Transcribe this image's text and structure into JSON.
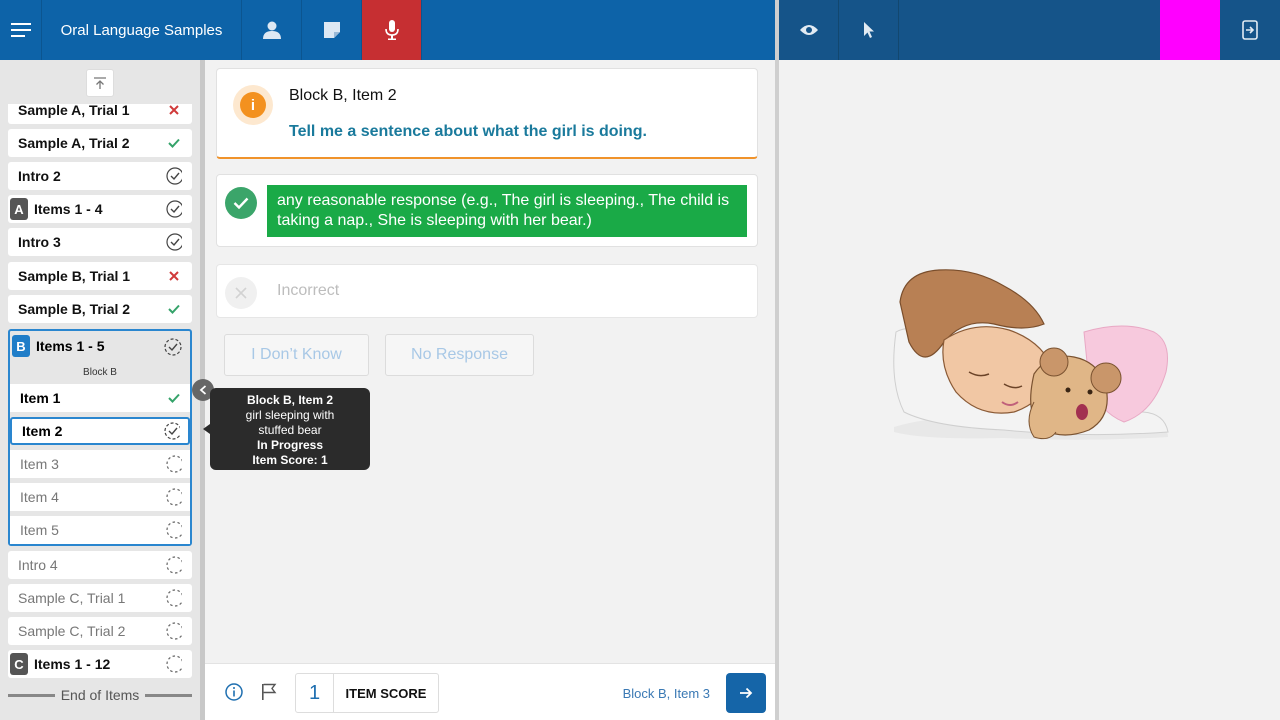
{
  "header": {
    "title": "Oral Language Samples",
    "icons": [
      "menu-icon",
      "user-icon",
      "note-icon",
      "microphone-icon",
      "eye-icon",
      "pointer-icon",
      "exit-icon"
    ],
    "colors": {
      "bar": "#0d63a8",
      "mic_active": "#c62f32",
      "right_bar": "#155489",
      "highlight": "#ff00ff"
    }
  },
  "sidebar": {
    "items": [
      {
        "label": "Sample A, Trial 1",
        "status": "incorrect"
      },
      {
        "label": "Sample A, Trial 2",
        "status": "correct"
      },
      {
        "label": "Intro 2",
        "status": "complete"
      },
      {
        "badge": "A",
        "label": "Items 1 - 4",
        "status": "complete"
      },
      {
        "label": "Intro 3",
        "status": "complete"
      },
      {
        "label": "Sample B, Trial 1",
        "status": "incorrect"
      },
      {
        "label": "Sample B, Trial 2",
        "status": "correct"
      }
    ],
    "group": {
      "badge": "B",
      "label": "Items 1 - 5",
      "sublabel": "Block B",
      "items": [
        {
          "label": "Item 1",
          "status": "correct"
        },
        {
          "label": "Item 2",
          "status": "in-progress"
        },
        {
          "label": "Item 3",
          "status": "pending"
        },
        {
          "label": "Item 4",
          "status": "pending"
        },
        {
          "label": "Item 5",
          "status": "pending"
        }
      ]
    },
    "after": [
      {
        "label": "Intro 4",
        "status": "pending"
      },
      {
        "label": "Sample C, Trial 1",
        "status": "pending"
      },
      {
        "label": "Sample C, Trial 2",
        "status": "pending"
      },
      {
        "badge": "C",
        "label": "Items 1 - 12",
        "status": "pending"
      }
    ],
    "end_label": "End of Items"
  },
  "question": {
    "title": "Block B, Item 2",
    "prompt": "Tell me a sentence about what the girl is doing."
  },
  "correct_response": "any reasonable response (e.g., The girl is sleeping., The child is taking a nap., She is sleeping with her bear.)",
  "incorrect_label": "Incorrect",
  "options": {
    "dont_know": "I Don’t Know",
    "no_response": "No Response"
  },
  "tooltip": {
    "title": "Block B, Item 2",
    "description": "girl sleeping with stuffed bear",
    "status": "In Progress",
    "score": "Item Score: 1"
  },
  "footer": {
    "score": "1",
    "score_label": "ITEM SCORE",
    "next_label": "Block B, Item 3"
  }
}
